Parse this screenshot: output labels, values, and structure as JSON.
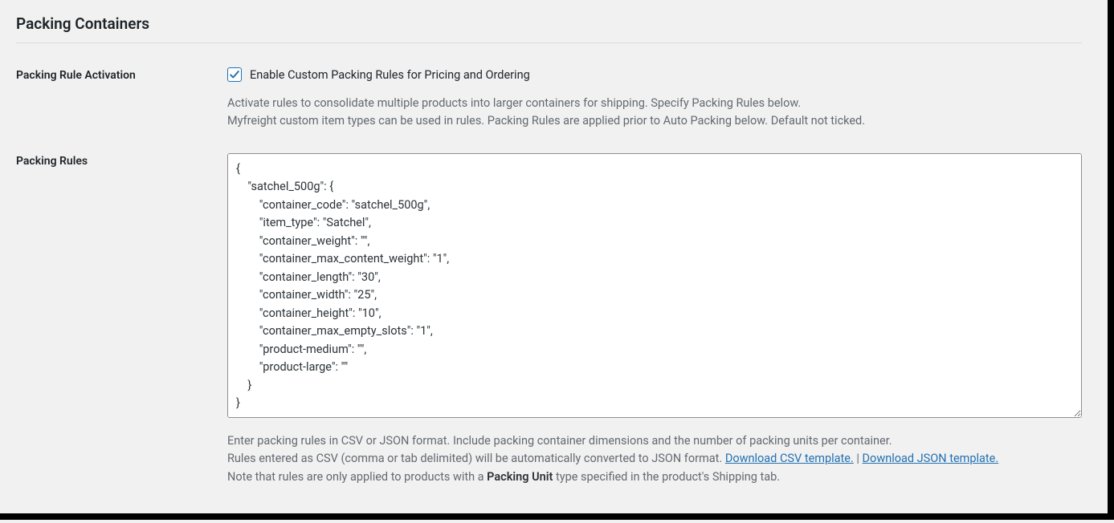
{
  "section": {
    "title": "Packing Containers"
  },
  "activation": {
    "label": "Packing Rule Activation",
    "checkbox_label": "Enable Custom Packing Rules for Pricing and Ordering",
    "checked": true,
    "help_line1": "Activate rules to consolidate multiple products into larger containers for shipping. Specify Packing Rules below.",
    "help_line2": "Myfreight custom item types can be used in rules. Packing Rules are applied prior to Auto Packing below. Default not ticked."
  },
  "rules": {
    "label": "Packing Rules",
    "value": "{\n    \"satchel_500g\": {\n        \"container_code\": \"satchel_500g\",\n        \"item_type\": \"Satchel\",\n        \"container_weight\": \"\",\n        \"container_max_content_weight\": \"1\",\n        \"container_length\": \"30\",\n        \"container_width\": \"25\",\n        \"container_height\": \"10\",\n        \"container_max_empty_slots\": \"1\",\n        \"product-medium\": \"\",\n        \"product-large\": \"\"\n    }\n}",
    "desc_line1": "Enter packing rules in CSV or JSON format. Include packing container dimensions and the number of packing units per container.",
    "desc_line2_prefix": "Rules entered as CSV (comma or tab delimited) will be automatically converted to JSON format. ",
    "link_csv": "Download CSV template.",
    "separator": " | ",
    "link_json": "Download JSON template.",
    "desc_line3_prefix": "Note that rules are only applied to products with a ",
    "desc_line3_bold": "Packing Unit",
    "desc_line3_suffix": " type specified in the product's Shipping tab."
  }
}
